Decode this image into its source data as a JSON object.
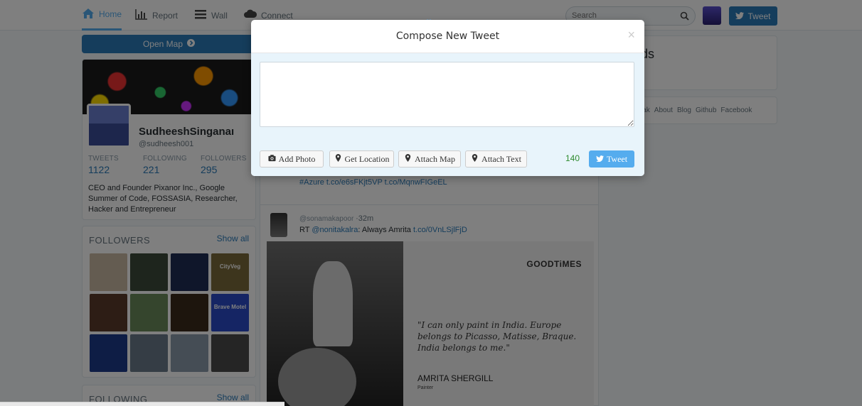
{
  "nav": {
    "home_label": "Home",
    "report_label": "Report",
    "wall_label": "Wall",
    "connect_label": "Connect",
    "search_placeholder": "Search",
    "tweet_label": "Tweet",
    "icons": {
      "home": "home-icon",
      "report": "bar-chart-icon",
      "wall": "list-icon",
      "connect": "cloud-icon",
      "search": "search-icon",
      "tweet": "twitter-bird-icon"
    }
  },
  "sidebar": {
    "open_map_label": "Open Map",
    "profile": {
      "name": "SudheeshSinganaı",
      "handle": "@sudheesh001",
      "stats": [
        {
          "label": "TWEETS",
          "value": "1122"
        },
        {
          "label": "FOLLOWING",
          "value": "221"
        },
        {
          "label": "FOLLOWERS",
          "value": "295"
        }
      ],
      "bio": "CEO and Founder Pixanor Inc., Google Summer of Code, FOSSASIA, Researcher, Hacker and Entrepreneur"
    },
    "followers": {
      "title": "FOLLOWERS",
      "show_all": "Show all",
      "thumbs": [
        {
          "label": "",
          "color": "#c9b9a2"
        },
        {
          "label": "",
          "color": "#3d4a3a"
        },
        {
          "label": "",
          "color": "#1e2d55"
        },
        {
          "label": "CityVeg",
          "color": "#7a6a3a"
        },
        {
          "label": "",
          "color": "#5a3a2a"
        },
        {
          "label": "",
          "color": "#6b8a5a"
        },
        {
          "label": "",
          "color": "#3a2a1a"
        },
        {
          "label": "Brave Motel",
          "color": "#2a4bc9"
        },
        {
          "label": "",
          "color": "#1d3a8a"
        },
        {
          "label": "",
          "color": "#6a7a8a"
        },
        {
          "label": "",
          "color": "#8a9aaa"
        },
        {
          "label": "",
          "color": "#4a4a4a"
        }
      ]
    },
    "following": {
      "title": "FOLLOWING",
      "show_all": "Show all"
    }
  },
  "feed": {
    "partial_text": "#Azure t.co/e6sFKjt5VP t.co/MqnwFIGeEL",
    "tweet": {
      "handle": "@sonamakapoor",
      "time": "·32m",
      "rt_prefix": "RT ",
      "mention": "@nonitakalra",
      "text": ": Always Amrita ",
      "link": "t.co/0VnLSjlFjD"
    },
    "media": {
      "brand": "GOODTiMES",
      "quote": "\"I can only paint in India. Europe belongs to Picasso, Matisse, Braque. India belongs to me.\"",
      "author": "AMRITA SHERGILL",
      "role": "Painter"
    }
  },
  "right": {
    "trends_title_partial": "ds",
    "footer_links": [
      "lak",
      "About",
      "Blog",
      "Github",
      "Facebook"
    ]
  },
  "modal": {
    "title": "Compose New Tweet",
    "close_glyph": "×",
    "textarea_value": "",
    "buttons": {
      "add_photo": "Add Photo",
      "get_location": "Get Location",
      "attach_map": "Attach Map",
      "attach_text": "Attach Text"
    },
    "char_count": "140",
    "tweet_label": "Tweet",
    "icons": {
      "add_photo": "camera-icon",
      "location": "map-marker-icon",
      "tweet": "twitter-bird-icon"
    }
  }
}
